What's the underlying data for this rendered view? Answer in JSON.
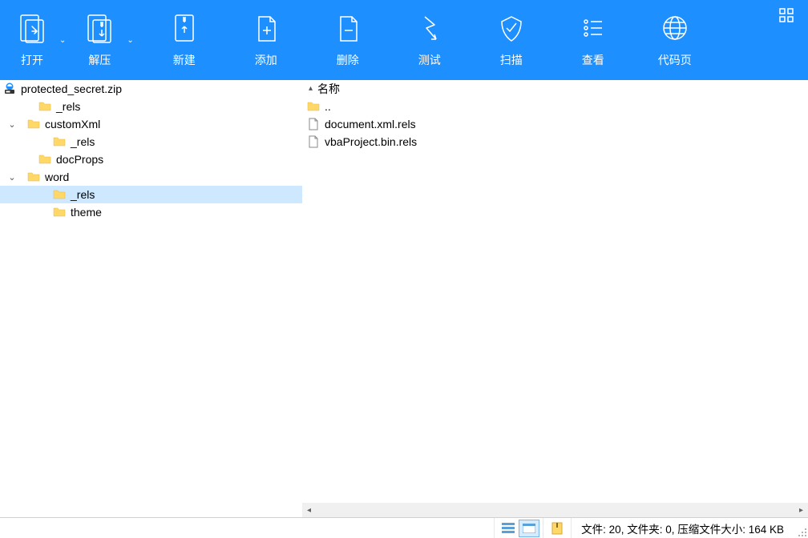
{
  "toolbar": {
    "open": "打开",
    "extract": "解压",
    "new": "新建",
    "add": "添加",
    "delete": "删除",
    "test": "测试",
    "scan": "扫描",
    "view": "查看",
    "codepage": "代码页"
  },
  "tree": {
    "root": "protected_secret.zip",
    "items": [
      {
        "label": "_rels",
        "indent": 2,
        "expander": ""
      },
      {
        "label": "customXml",
        "indent": 1,
        "expander": "⌄"
      },
      {
        "label": "_rels",
        "indent": 3,
        "expander": ""
      },
      {
        "label": "docProps",
        "indent": 2,
        "expander": ""
      },
      {
        "label": "word",
        "indent": 1,
        "expander": "⌄"
      },
      {
        "label": "_rels",
        "indent": 3,
        "expander": "",
        "selected": true
      },
      {
        "label": "theme",
        "indent": 3,
        "expander": ""
      }
    ]
  },
  "content": {
    "header": "名称",
    "files": [
      {
        "name": "..",
        "type": "folder"
      },
      {
        "name": "document.xml.rels",
        "type": "file"
      },
      {
        "name": "vbaProject.bin.rels",
        "type": "file"
      }
    ]
  },
  "status": {
    "text": "文件: 20, 文件夹: 0, 压缩文件大小: 164 KB"
  }
}
